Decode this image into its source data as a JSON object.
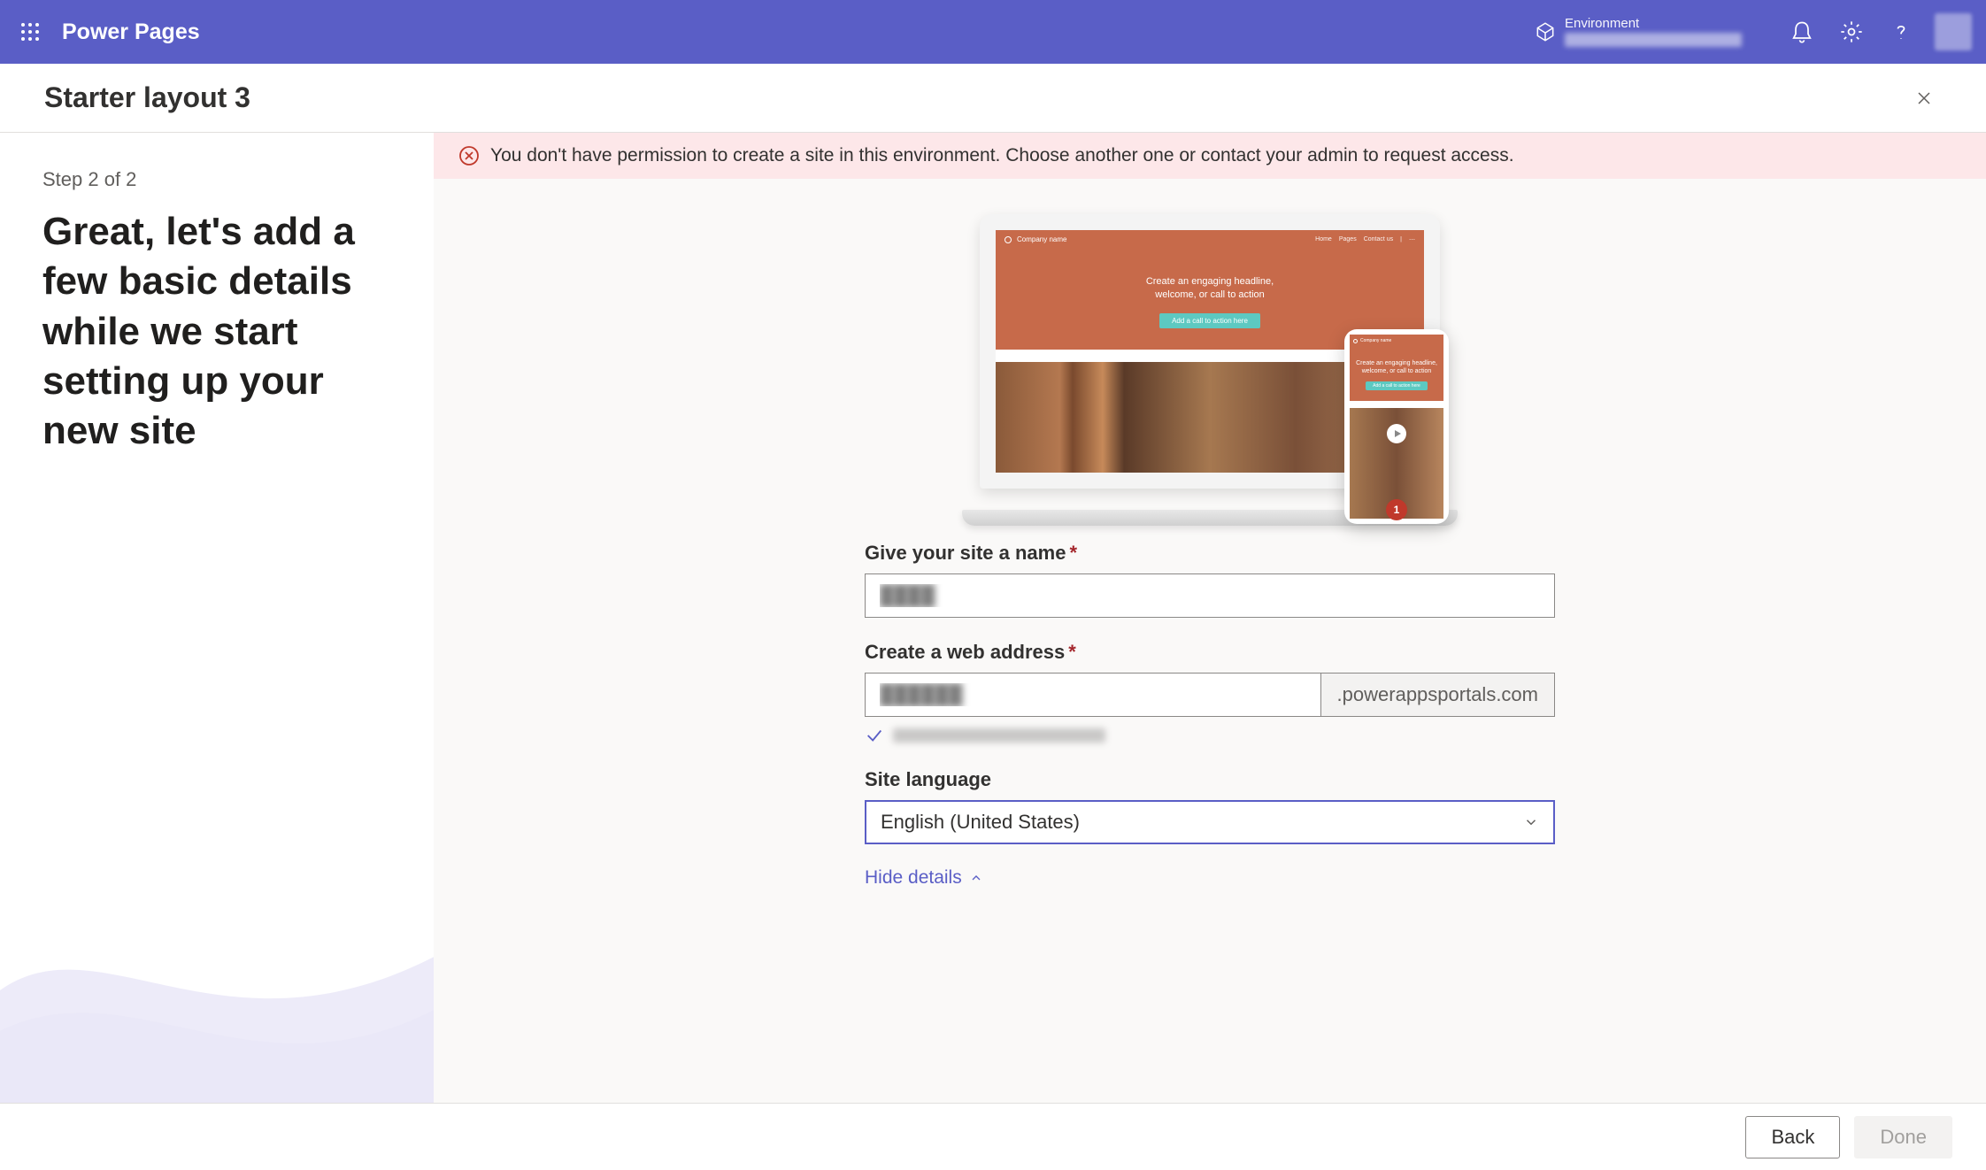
{
  "topbar": {
    "brand": "Power Pages",
    "env_label": "Environment"
  },
  "titlebar": {
    "title": "Starter layout 3"
  },
  "sidebar": {
    "step": "Step 2 of 2",
    "headline": "Great, let's add a few basic details while we start setting up your new site"
  },
  "error": {
    "message": "You don't have permission to create a site in this environment. Choose another one or contact your admin to request access."
  },
  "preview": {
    "company": "Company name",
    "nav_items": [
      "Home",
      "Pages",
      "Contact us"
    ],
    "hero_line1": "Create an engaging headline,",
    "hero_line2": "welcome, or call to action",
    "cta": "Add a call to action here",
    "badge": "1"
  },
  "form": {
    "site_name_label": "Give your site a name",
    "web_address_label": "Create a web address",
    "domain_suffix": ".powerappsportals.com",
    "language_label": "Site language",
    "language_value": "English (United States)",
    "toggle_details": "Hide details"
  },
  "footer": {
    "back": "Back",
    "done": "Done"
  }
}
